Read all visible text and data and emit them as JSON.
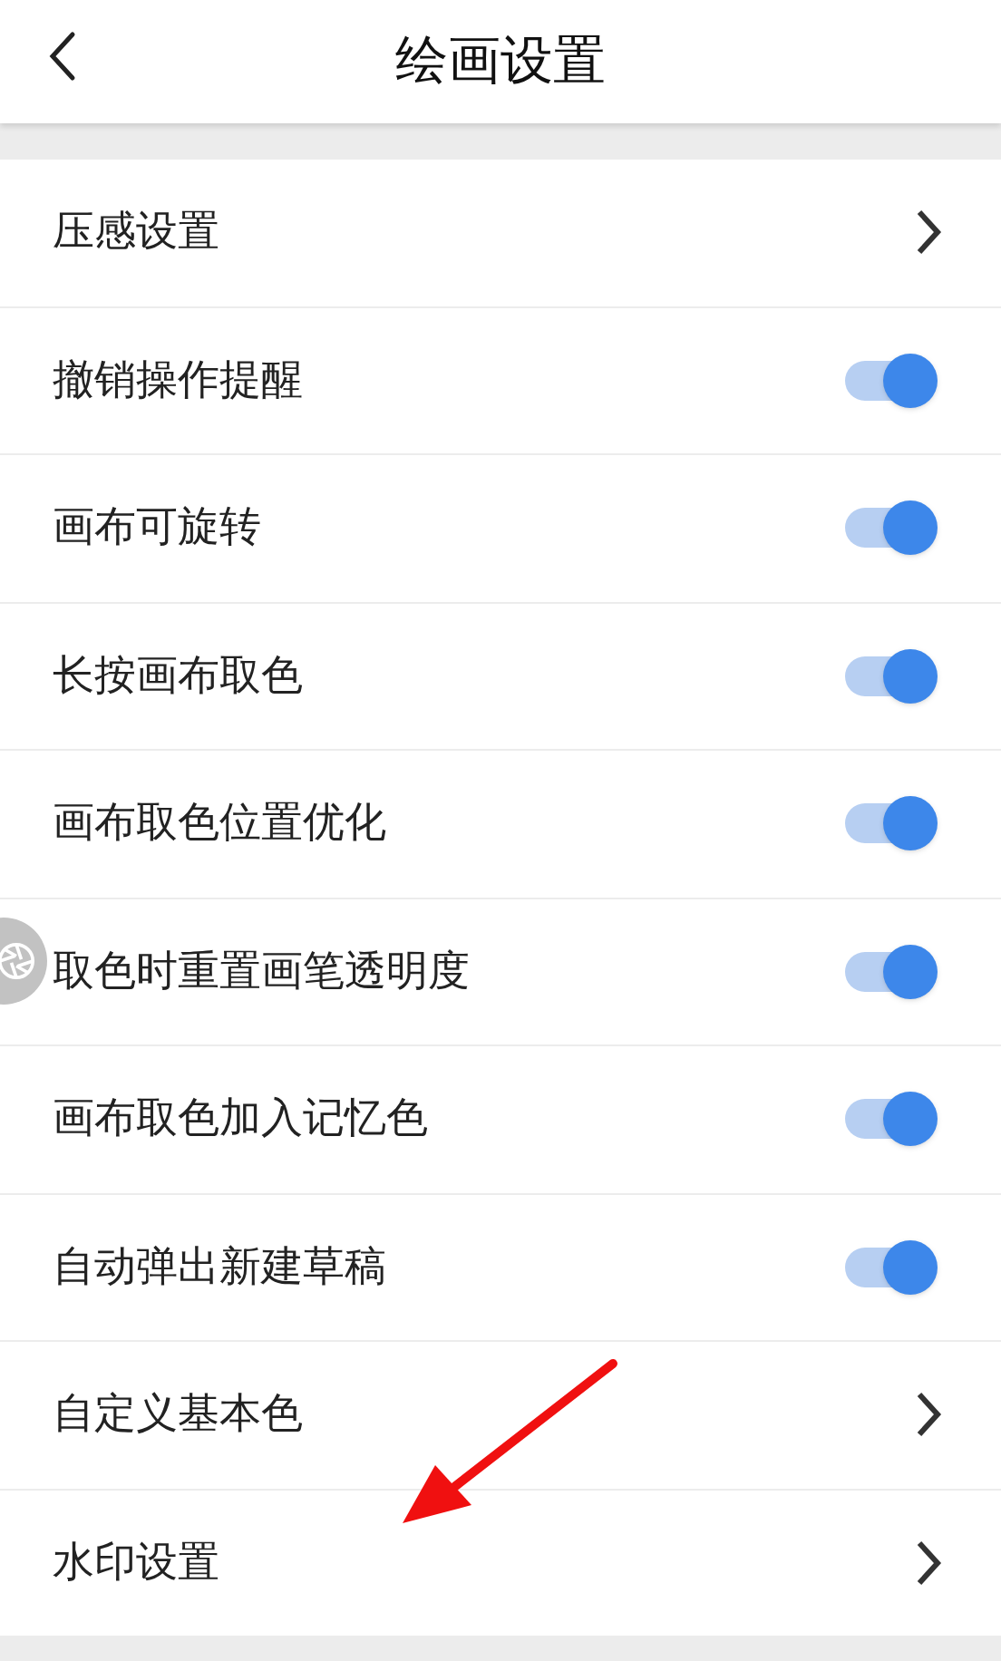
{
  "header": {
    "title": "绘画设置"
  },
  "settings": [
    {
      "label": "压感设置",
      "kind": "link"
    },
    {
      "label": "撤销操作提醒",
      "kind": "toggle",
      "on": true
    },
    {
      "label": "画布可旋转",
      "kind": "toggle",
      "on": true
    },
    {
      "label": "长按画布取色",
      "kind": "toggle",
      "on": true
    },
    {
      "label": "画布取色位置优化",
      "kind": "toggle",
      "on": true
    },
    {
      "label": "取色时重置画笔透明度",
      "kind": "toggle",
      "on": true
    },
    {
      "label": "画布取色加入记忆色",
      "kind": "toggle",
      "on": true
    },
    {
      "label": "自动弹出新建草稿",
      "kind": "toggle",
      "on": true
    },
    {
      "label": "自定义基本色",
      "kind": "link"
    },
    {
      "label": "水印设置",
      "kind": "link"
    }
  ]
}
